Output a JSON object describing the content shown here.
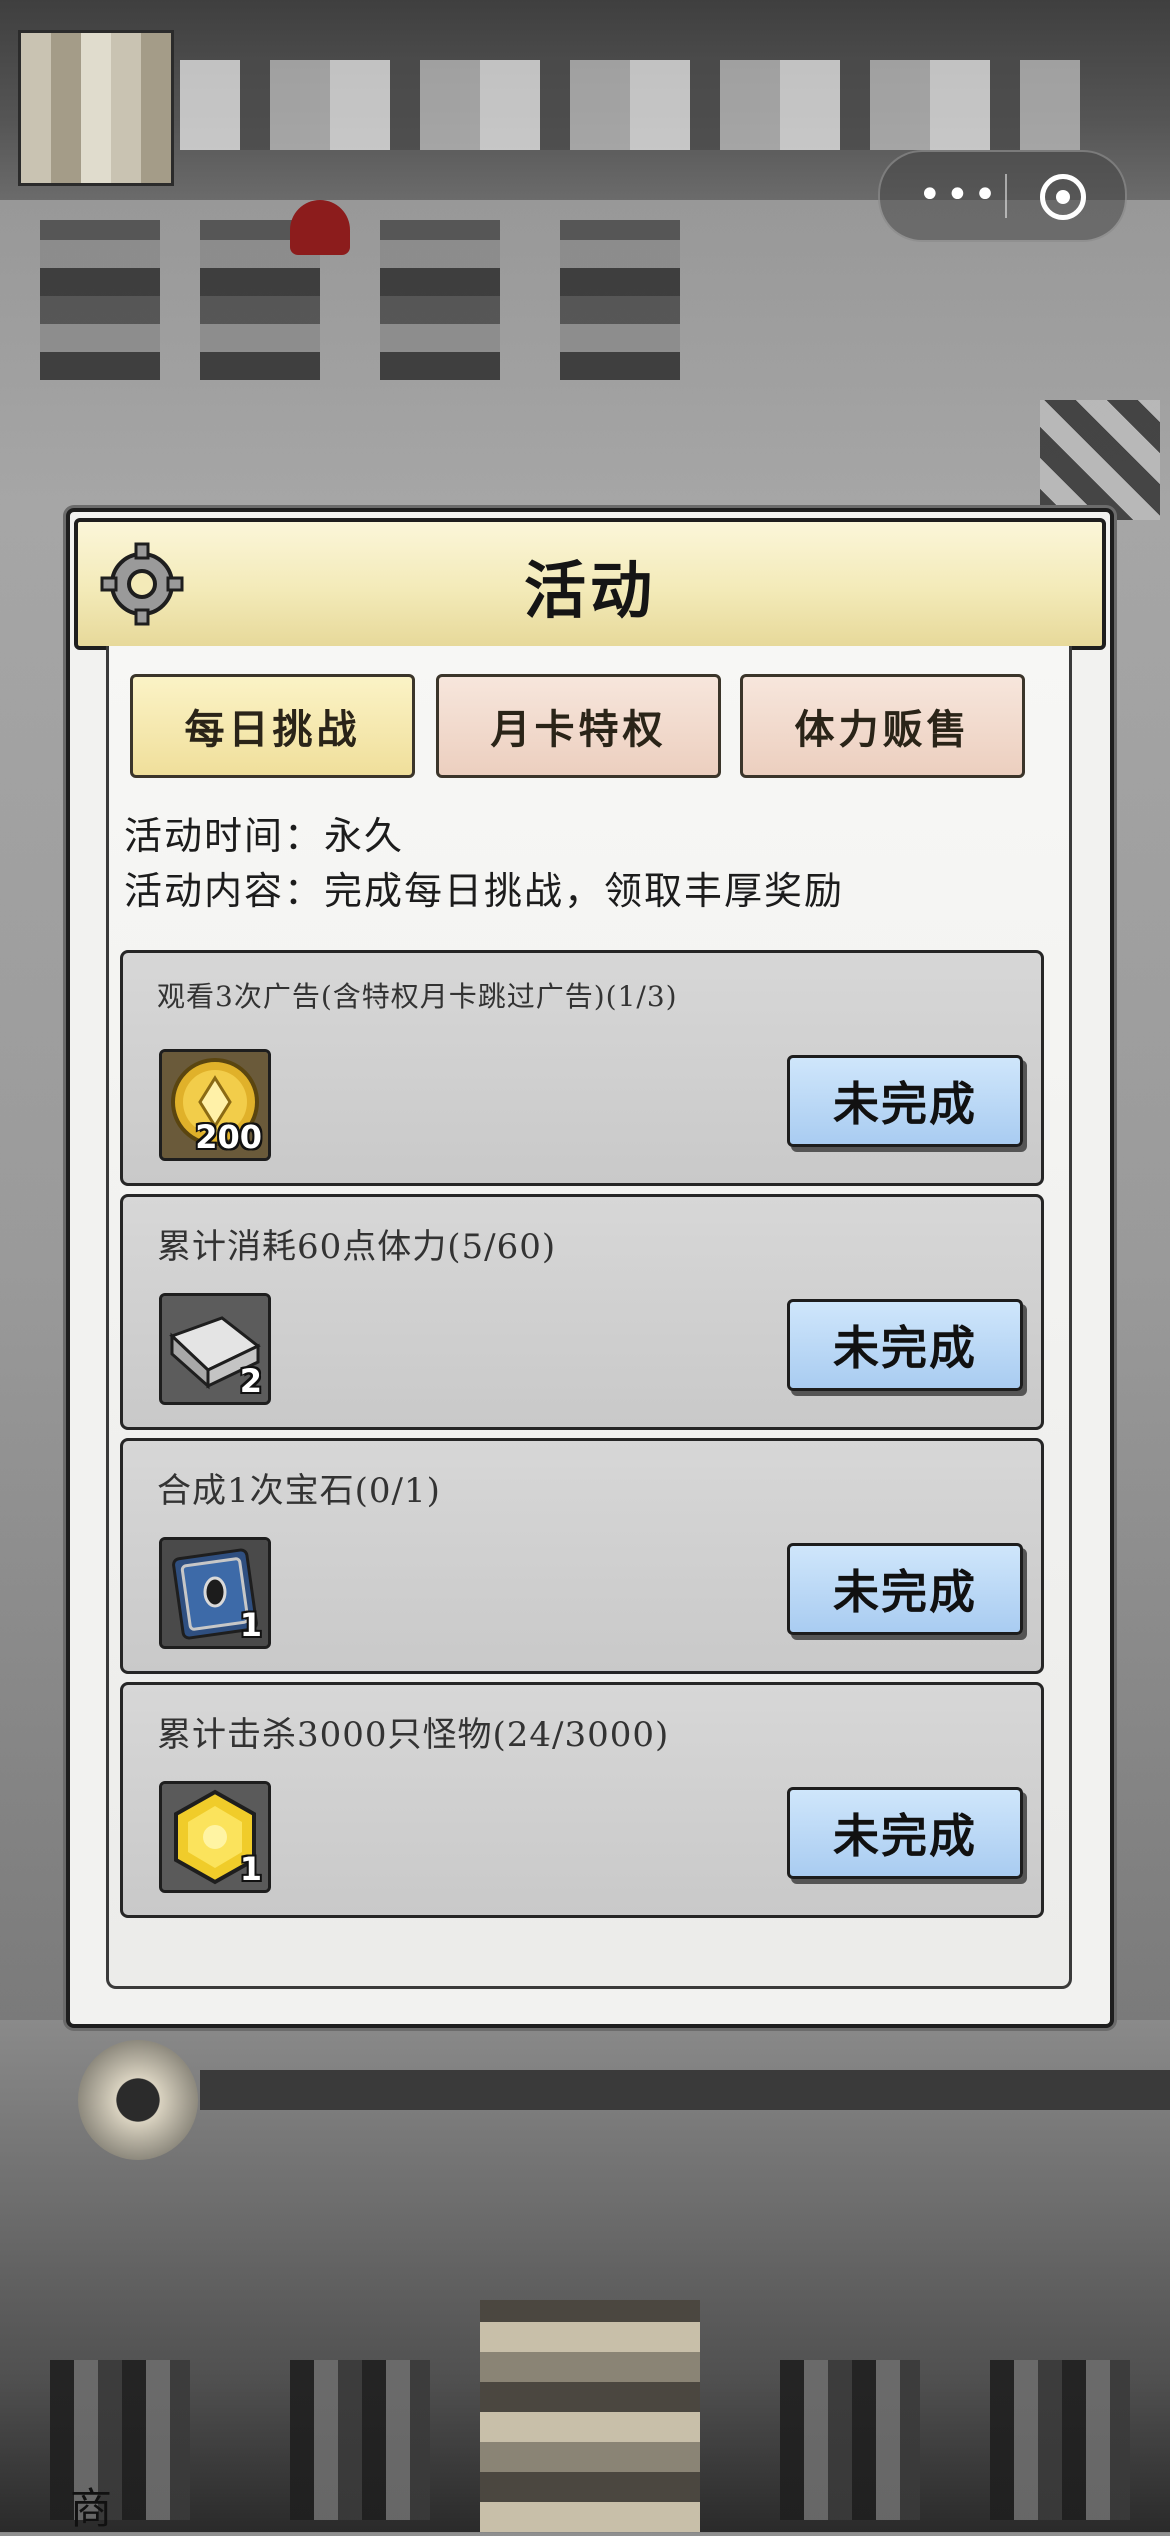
{
  "modal": {
    "title": "活动",
    "tabs": [
      {
        "label": "每日挑战",
        "active": true
      },
      {
        "label": "月卡特权",
        "active": false
      },
      {
        "label": "体力贩售",
        "active": false
      }
    ],
    "info": {
      "time": "活动时间：永久",
      "content": "活动内容：完成每日挑战，领取丰厚奖励"
    },
    "tasks": [
      {
        "title": "观看3次广告(含特权月卡跳过广告)(1/3)",
        "reward_icon": "gold-coin-icon",
        "reward_qty": "200",
        "status": "未完成"
      },
      {
        "title": "累计消耗60点体力(5/60)",
        "reward_icon": "iron-ingot-icon",
        "reward_qty": "2",
        "status": "未完成"
      },
      {
        "title": "合成1次宝石(0/1)",
        "reward_icon": "gem-book-icon",
        "reward_qty": "1",
        "status": "未完成"
      },
      {
        "title": "累计击杀3000只怪物(24/3000)",
        "reward_icon": "gold-hexagon-icon",
        "reward_qty": "1",
        "status": "未完成"
      }
    ]
  },
  "bottom_nav": {
    "first_label": "商"
  },
  "colors": {
    "tab_active": "#f0df9b",
    "tab_inactive": "#eccfbf",
    "status_button": "#a9ccf1",
    "header": "#f3eab8"
  }
}
